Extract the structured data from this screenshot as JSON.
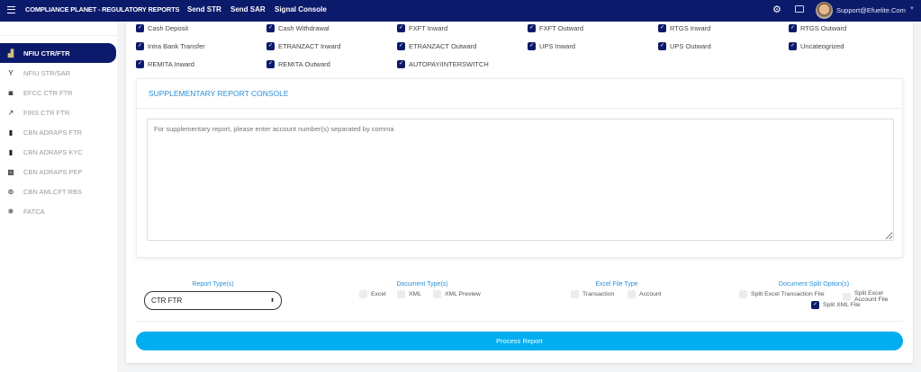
{
  "header": {
    "title": "COMPLIANCE PLANET - REGULATORY REPORTS",
    "links": [
      "Send STR",
      "Send SAR",
      "Signal Console"
    ],
    "user": "Support@Efuelite.Com"
  },
  "sidebar": {
    "items": [
      {
        "label": "NFIU CTR/FTR",
        "icon": "bar-chart-icon",
        "active": true
      },
      {
        "label": "NFIU STR/SAR",
        "icon": "cocktail-icon"
      },
      {
        "label": "EFCC CTR FTR",
        "icon": "outlet-icon"
      },
      {
        "label": "FIRS CTR FTR",
        "icon": "trending-up-icon"
      },
      {
        "label": "CBN ADRAPS FTR",
        "icon": "map-icon"
      },
      {
        "label": "CBN ADRAPS KYC",
        "icon": "file-icon"
      },
      {
        "label": "CBN ADRAPS PEP",
        "icon": "image-chart-icon"
      },
      {
        "label": "CBN AMLCFT RBS",
        "icon": "soccer-ball-icon"
      },
      {
        "label": "FATCA",
        "icon": "snowflake-icon"
      }
    ]
  },
  "categories": [
    {
      "label": "Cash Deposit",
      "checked": true
    },
    {
      "label": "Cash Withdrawal",
      "checked": true
    },
    {
      "label": "FXFT Inward",
      "checked": true
    },
    {
      "label": "FXFT Outward",
      "checked": true
    },
    {
      "label": "RTGS Inward",
      "checked": true
    },
    {
      "label": "RTGS Outward",
      "checked": true
    },
    {
      "label": "Intra Bank Transfer",
      "checked": true
    },
    {
      "label": "ETRANZACT Inward",
      "checked": true
    },
    {
      "label": "ETRANZACT Outward",
      "checked": true
    },
    {
      "label": "UPS Inward",
      "checked": true
    },
    {
      "label": "UPS Outward",
      "checked": true
    },
    {
      "label": "Uncateogrized",
      "checked": true
    },
    {
      "label": "REMITA Inward",
      "checked": true
    },
    {
      "label": "REMITA Outward",
      "checked": true
    },
    {
      "label": "AUTOPAY/INTERSWITCH",
      "checked": true
    }
  ],
  "supplementary": {
    "title": "SUPPLEMENTARY REPORT CONSOLE",
    "placeholder": "For supplementary report, please enter account number(s) separated by comma"
  },
  "options": {
    "report_type_label": "Report Type(s)",
    "report_type_value": "CTR FTR",
    "document_type_label": "Document Type(s)",
    "document_types": [
      {
        "label": "Excel",
        "checked": false
      },
      {
        "label": "XML",
        "checked": false
      },
      {
        "label": "XML Preview",
        "checked": false
      }
    ],
    "excel_type_label": "Excel File Type",
    "excel_types": [
      {
        "label": "Transaction",
        "checked": false
      },
      {
        "label": "Account",
        "checked": false
      }
    ],
    "split_label": "Document Split Option(s)",
    "splits": [
      {
        "label": "Split Excel Transaction File",
        "checked": false
      },
      {
        "label": "Split Excel Account File",
        "checked": false
      },
      {
        "label": "Split XML File",
        "checked": true
      }
    ]
  },
  "process_label": "Process Report"
}
